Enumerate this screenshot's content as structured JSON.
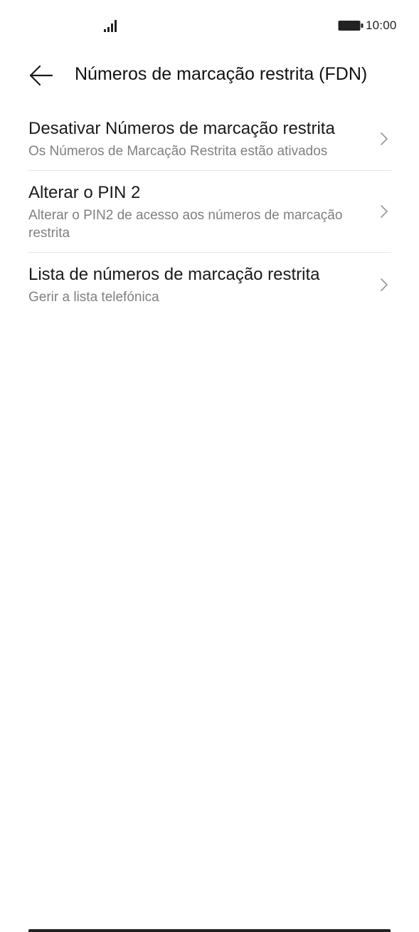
{
  "status_bar": {
    "time": "10:00",
    "signal_icon": "signal-bars-icon",
    "battery_icon": "battery-icon"
  },
  "header": {
    "back_icon": "arrow-left-icon",
    "title": "Números de marcação restrita (FDN)"
  },
  "items": [
    {
      "title": "Desativar Números de marcação restrita",
      "subtitle": "Os Números de Marcação Restrita estão ativados"
    },
    {
      "title": "Alterar o PIN 2",
      "subtitle": "Alterar o PIN2 de acesso aos números de marcação restrita"
    },
    {
      "title": "Lista de números de marcação restrita",
      "subtitle": "Gerir a lista telefónica"
    }
  ],
  "colors": {
    "background": "#ffffff",
    "title_text": "#1a1a1a",
    "subtitle_text": "#808080",
    "divider": "#e6e6e6"
  }
}
